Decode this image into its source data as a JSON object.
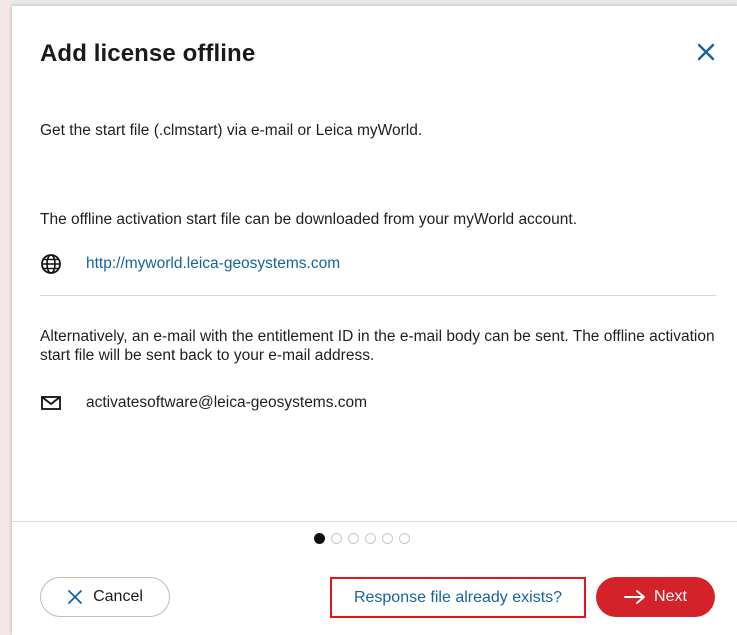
{
  "dialog": {
    "title": "Add license offline",
    "intro": "Get the start file (.clmstart) via e-mail or Leica myWorld.",
    "myworld_text": "The offline activation start file can be downloaded from your myWorld account.",
    "myworld_link": "http://myworld.leica-geosystems.com",
    "email_text": "Alternatively, an e-mail with the entitlement ID in the e-mail body can be sent. The offline activation start file will be sent back to your e-mail address.",
    "email_address": "activatesoftware@leica-geosystems.com"
  },
  "pager": {
    "total": 6,
    "current": 1
  },
  "footer": {
    "cancel_label": "Cancel",
    "response_link": "Response file already exists?",
    "next_label": "Next"
  },
  "colors": {
    "accent_red": "#d3222a",
    "link_blue": "#1464a0",
    "highlight_red": "#e8141b"
  },
  "icons": {
    "close": "close-icon",
    "web": "globe-icon",
    "mail": "mail-icon",
    "cancel": "x-icon",
    "next": "arrow-right-icon"
  }
}
